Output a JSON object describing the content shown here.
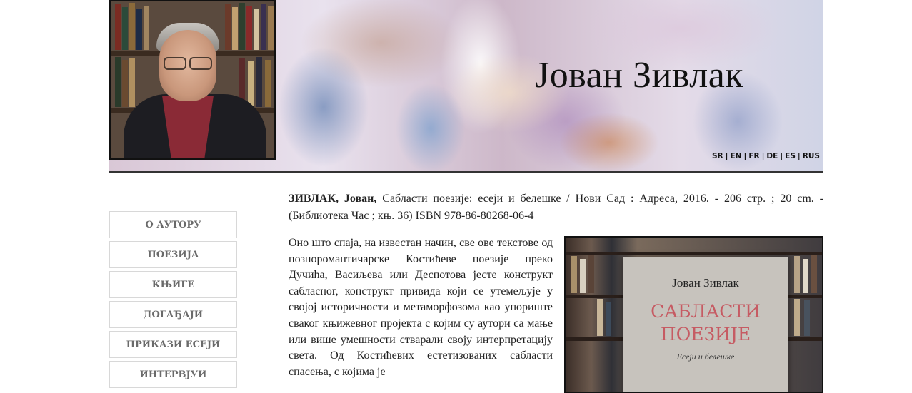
{
  "header": {
    "site_title": "Јован Зивлак",
    "languages": [
      "SR",
      "EN",
      "FR",
      "DE",
      "ES",
      "RUS"
    ]
  },
  "nav": {
    "items": [
      "О АУТОРУ",
      "ПОЕЗИЈА",
      "КЊИГЕ",
      "ДОГАЂАЈИ",
      "ПРИКАЗИ ЕСЕЈИ",
      "ИНТЕРВЈУИ"
    ]
  },
  "article": {
    "citation_author": "ЗИВЛАК, Јован,",
    "citation_rest": " Сабласти поезије: есеји и белешке / Нови Сад : Адреса, 2016. - 206 стр. ; 20 cm. - (Библиотека Час ; књ. 36) ISBN 978-86-80268-06-4",
    "body": "Оно што спаја, на известан начин, све ове текстове од познoромантичарске Костићеве поезије преко Дучића, Васиљева или Деспотова јесте конструкт сабласног, конструкт привида који се утемељује у својој историчности и метаморфозома као упориште сваког књижевног пројекта с којим су аутори са мање или више умешности стварали своју интерпретацију света. Од Костићевих естетизованих сабласти спасења, с којима је"
  },
  "book": {
    "author": "Јован Зивлак",
    "title_line1": "САБЛАСТИ",
    "title_line2": "ПОЕЗИЈЕ",
    "subtitle": "Есеји и белешке"
  }
}
